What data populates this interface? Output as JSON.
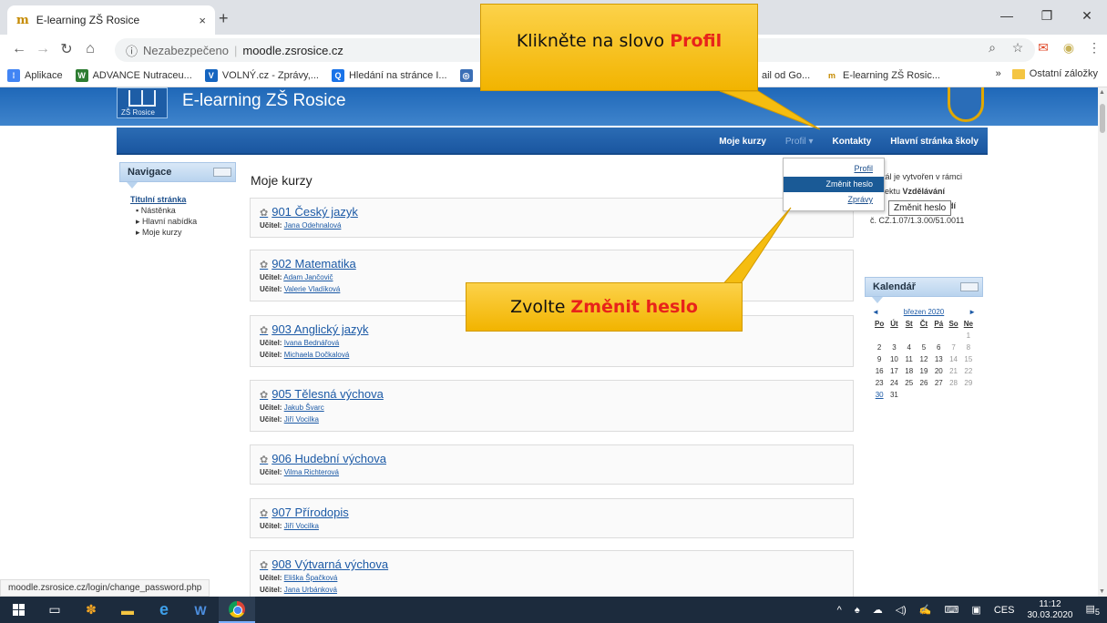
{
  "browser": {
    "tab_title": "E-learning ZŠ Rosice",
    "tab_close": "×",
    "new_tab": "+",
    "insecure_label": "Nezabezpečeno",
    "url": "moodle.zsrosice.cz",
    "bookmarks": [
      {
        "label": "Aplikace",
        "color": "#4285f4"
      },
      {
        "label": "ADVANCE Nutraceu...",
        "color": "#2e7d32"
      },
      {
        "label": "VOLNÝ.cz - Zprávy,...",
        "color": "#1565c0"
      },
      {
        "label": "Hledání na stránce I...",
        "color": "#1a73e8"
      },
      {
        "label": "",
        "color": "#4285f4"
      },
      {
        "label": "ail od Go...",
        "color": "#ffffff"
      },
      {
        "label": "E-learning ZŠ Rosic...",
        "color": "#c58a00"
      }
    ],
    "bookmarks_more": "»",
    "other_bookmarks": "Ostatní záložky",
    "status_url": "moodle.zsrosice.cz/login/change_password.php"
  },
  "site": {
    "name": "E-learning ZŠ Rosice",
    "logo_label": "ZŠ Rosice",
    "nav": [
      {
        "label": "Moje kurzy"
      },
      {
        "label": "Profil ▾"
      },
      {
        "label": "Kontakty"
      },
      {
        "label": "Hlavní stránka školy"
      }
    ]
  },
  "navigation_block": {
    "title": "Navigace",
    "home": "Titulní stránka",
    "items": [
      "Nástěnka",
      "Hlavní nabídka",
      "Moje kurzy"
    ]
  },
  "main": {
    "title": "Moje kurzy",
    "courses": [
      {
        "name": "901 Český jazyk",
        "teachers": [
          "Jana Odehnalová"
        ]
      },
      {
        "name": "902 Matematika",
        "teachers": [
          "Adam Jančovič",
          "Valerie Vladíková"
        ]
      },
      {
        "name": "903 Anglický jazyk",
        "teachers": [
          "Ivana Bednářová",
          "Michaela Dočkalová"
        ]
      },
      {
        "name": "905 Tělesná výchova",
        "teachers": [
          "Jakub Švarc",
          "Jiří Vocilka"
        ]
      },
      {
        "name": "906 Hudební výchova",
        "teachers": [
          "Vilma Richterová"
        ]
      },
      {
        "name": "907 Přírodopis",
        "teachers": [
          "Jiří Vocilka"
        ]
      },
      {
        "name": "908 Výtvarná výchova",
        "teachers": [
          "Eliška Špačková",
          "Jana Urbánková"
        ]
      }
    ],
    "teacher_label": "Učitel:"
  },
  "right_text": {
    "line1": "tál je vytvořen v rámci",
    "line2_prefix": "ektu ",
    "line2_bold": "Vzdělávání",
    "line3_prefix": "ciol",
    "line3_bold": "dí",
    "line4": "č. CZ.1.07/1.3.00/51.0011"
  },
  "calendar": {
    "title": "Kalendář",
    "month": "březen 2020",
    "prev": "◄",
    "next": "►",
    "days": [
      "Po",
      "Út",
      "St",
      "Čt",
      "Pá",
      "So",
      "Ne"
    ]
  },
  "dropdown": {
    "items": [
      "Profil",
      "Změnit heslo",
      "Zprávy"
    ],
    "tooltip": "Změnit heslo"
  },
  "callouts": {
    "c1_text": "Klikněte na slovo ",
    "c1_highlight": "Profil",
    "c2_text": "Zvolte ",
    "c2_highlight": "Změnit heslo",
    "highlight_color": "#e8231a",
    "bg_color": "#f7c21e"
  },
  "taskbar": {
    "lang": "CES",
    "time": "11:12",
    "date": "30.03.2020",
    "notifications": "5"
  }
}
